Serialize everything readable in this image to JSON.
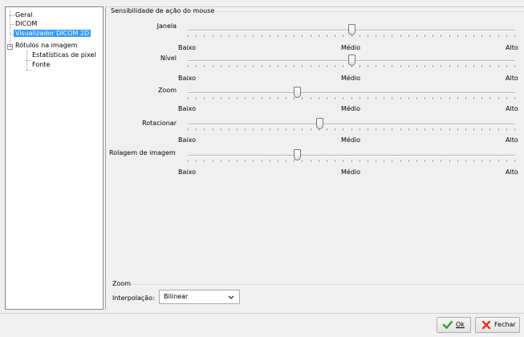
{
  "tree": {
    "items": [
      {
        "label": "Geral"
      },
      {
        "label": "DICOM"
      },
      {
        "label": "Visualizador DICOM 2D"
      },
      {
        "label": "Rótulos na imagem"
      },
      {
        "label": "Estatísticas de pixel"
      },
      {
        "label": "Fonte"
      }
    ],
    "expander_symbol": "−"
  },
  "sensitivity": {
    "title": "Sensibilidade de ação do mouse",
    "scale": {
      "low": "Baixo",
      "mid": "Médio",
      "high": "Alto"
    },
    "sliders": [
      {
        "label": "Janela",
        "value": 0.5
      },
      {
        "label": "Nível",
        "value": 0.5
      },
      {
        "label": "Zoom",
        "value": 0.33
      },
      {
        "label": "Rotacionar",
        "value": 0.4
      },
      {
        "label": "Rolagem de imagem",
        "value": 0.33
      }
    ]
  },
  "zoom": {
    "title": "Zoom",
    "interpolation_label": "Interpolação:",
    "interpolation_value": "Bilinear",
    "dropdown_icon": "chevron-down-icon"
  },
  "buttons": {
    "ok": {
      "label": "Ok",
      "icon": "checkmark-icon",
      "icon_color": "#2e9e2e"
    },
    "close": {
      "label": "Fechar",
      "icon": "close-x-icon",
      "icon_color": "#d8342a"
    }
  },
  "colors": {
    "selection": "#3399ff",
    "background": "#f0f0f0"
  }
}
